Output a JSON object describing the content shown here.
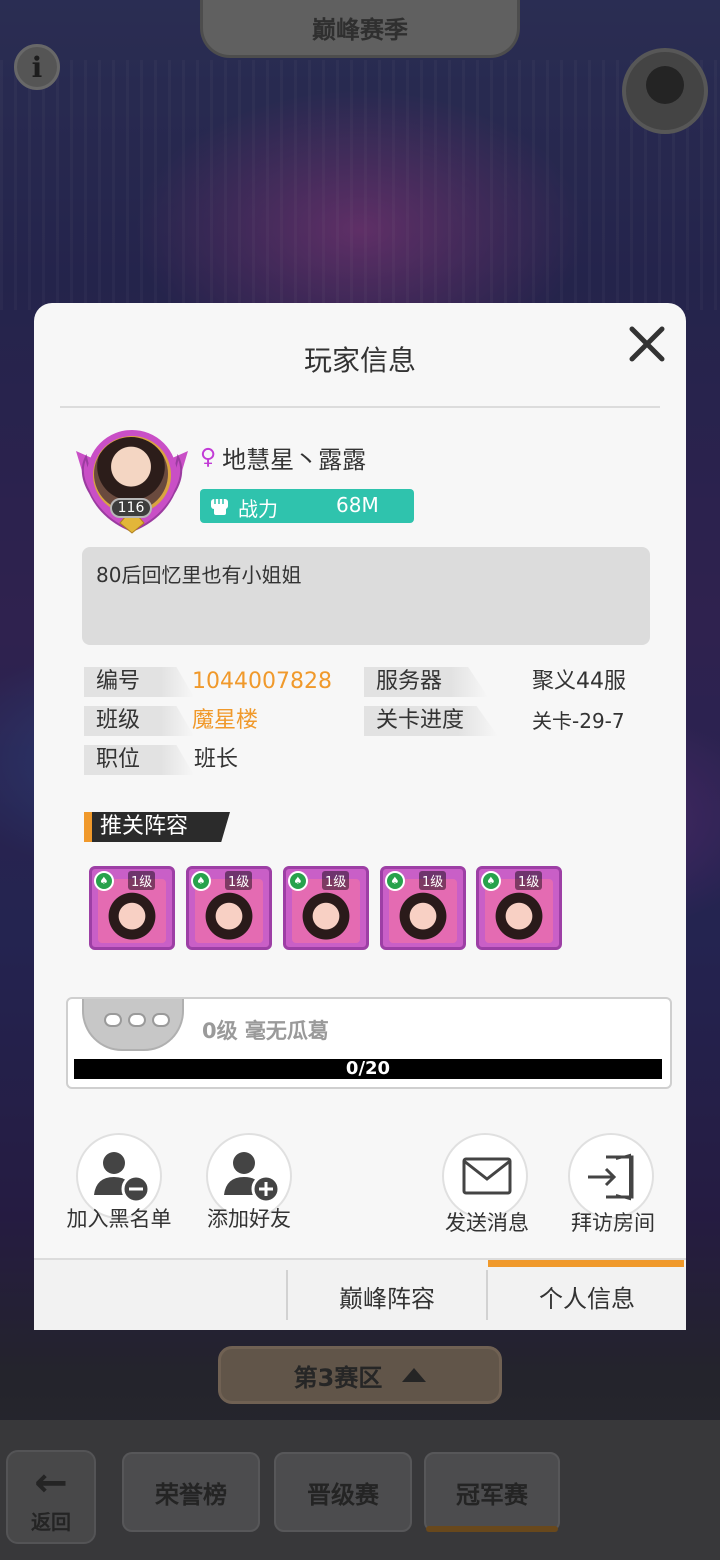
{
  "background": {
    "top_tab_label": "巅峰赛季",
    "region_label": "第3赛区",
    "bottom_nav": [
      {
        "label": "返回"
      },
      {
        "label": "荣誉榜"
      },
      {
        "label": "晋级赛"
      },
      {
        "label": "冠军赛"
      }
    ]
  },
  "dialog": {
    "title": "玩家信息",
    "player": {
      "gender_icon": "female-icon",
      "name": "地慧星丶露露",
      "avatar_level": "116",
      "power_label": "战力",
      "power_value": "68M",
      "signature": "80后回忆里也有小姐姐"
    },
    "info": {
      "id_label": "编号",
      "id_value": "1044007828",
      "server_label": "服务器",
      "server_value": "聚义44服",
      "class_label": "班级",
      "class_value": "魔星楼",
      "stage_label": "关卡进度",
      "stage_value": "关卡-29-7",
      "position_label": "职位",
      "position_value": "班长"
    },
    "lineup": {
      "title": "推关阵容",
      "heroes": [
        {
          "level": "1级"
        },
        {
          "level": "1级"
        },
        {
          "level": "1级"
        },
        {
          "level": "1级"
        },
        {
          "level": "1级"
        }
      ]
    },
    "rank": {
      "label": "0级 毫无瓜葛",
      "progress_text": "0/20",
      "progress_fraction": 0
    },
    "actions": {
      "blacklist": "加入黑名单",
      "add_friend": "添加好友",
      "send_message": "发送消息",
      "visit_room": "拜访房间"
    },
    "tabs": {
      "peak_lineup": "巅峰阵容",
      "personal_info": "个人信息"
    },
    "colors": {
      "accent": "#f0992b",
      "power": "#2fc3ad",
      "gender": "#c23bd6"
    }
  }
}
